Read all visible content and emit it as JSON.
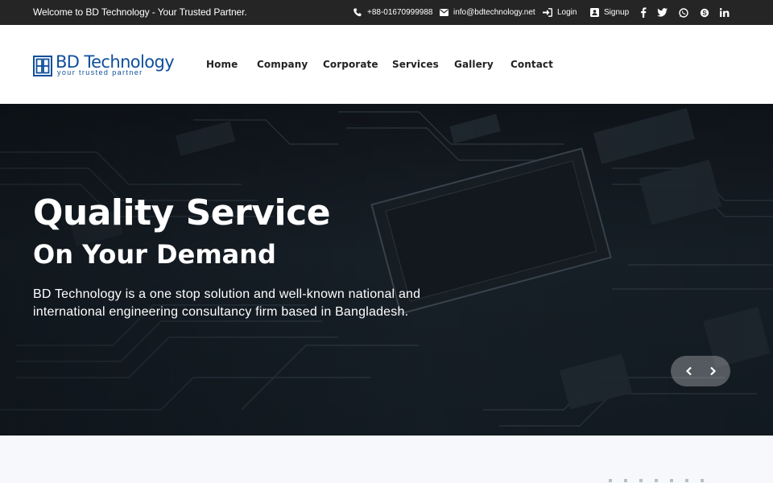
{
  "topbar": {
    "welcome": "Welcome to BD Technology - Your Trusted Partner.",
    "phone": "+88-01670999988",
    "email": "info@bdtechnology.net",
    "login": "Login",
    "signup": "Signup",
    "social": [
      "facebook-icon",
      "twitter-icon",
      "whatsapp-icon",
      "skype-icon",
      "linkedin-icon"
    ],
    "colors": {
      "background": "#252525",
      "text": "#ffffff"
    }
  },
  "header": {
    "logo": {
      "name": "BD Technology",
      "tagline": "your trusted partner",
      "color": "#0f4f9a"
    },
    "nav": [
      "Home",
      "Company",
      "Corporate",
      "Services",
      "Gallery",
      "Contact"
    ]
  },
  "hero": {
    "title": "Quality Service",
    "subtitle": "On Your Demand",
    "description": "BD Technology is a one stop solution and well-known national and international engineering consultancy firm based in Bangladesh.",
    "prev_icon": "chevron-left-icon",
    "next_icon": "chevron-right-icon"
  }
}
